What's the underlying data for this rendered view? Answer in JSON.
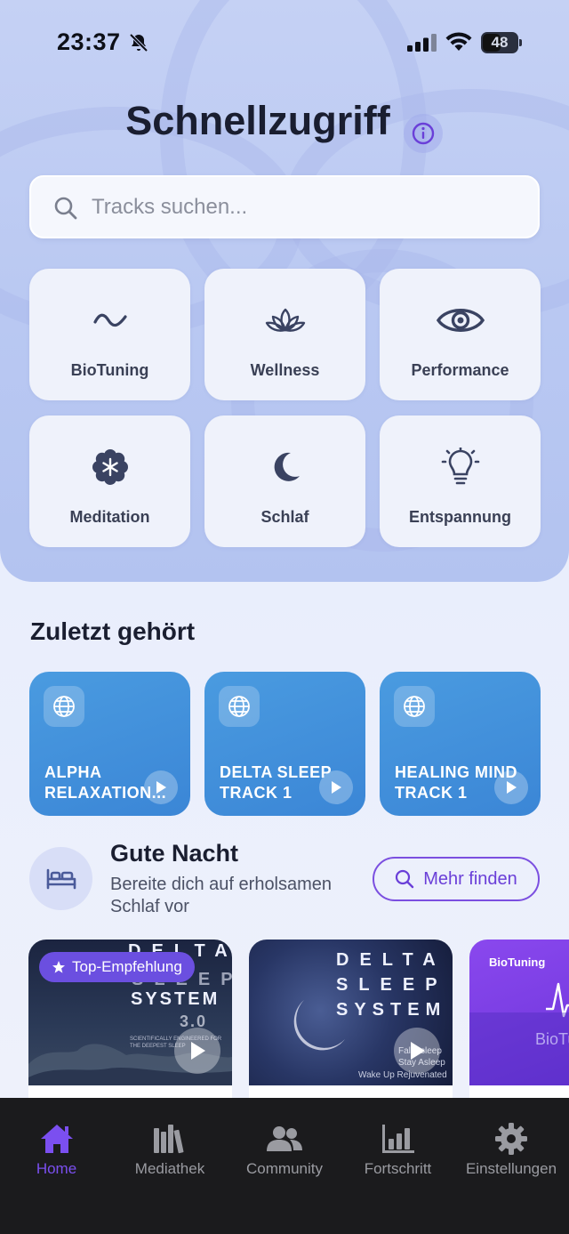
{
  "status_bar": {
    "time": "23:37",
    "battery": "48"
  },
  "header": {
    "title": "Schnellzugriff"
  },
  "search": {
    "placeholder": "Tracks suchen..."
  },
  "categories": [
    {
      "label": "BioTuning",
      "icon": "wave-icon"
    },
    {
      "label": "Wellness",
      "icon": "lotus-icon"
    },
    {
      "label": "Performance",
      "icon": "eye-icon"
    },
    {
      "label": "Meditation",
      "icon": "asterisk-flower-icon"
    },
    {
      "label": "Schlaf",
      "icon": "moon-icon"
    },
    {
      "label": "Entspannung",
      "icon": "lightbulb-icon"
    }
  ],
  "recent": {
    "title": "Zuletzt gehört",
    "items": [
      {
        "label": "ALPHA\nRELAXATION..."
      },
      {
        "label": "DELTA SLEEP\nTRACK 1"
      },
      {
        "label": "HEALING MIND\nTRACK 1"
      }
    ]
  },
  "good_night": {
    "title": "Gute Nacht",
    "subtitle": "Bereite dich auf erholsamen Schlaf vor",
    "more_button": "Mehr finden",
    "badge": "Top-Empfehlung",
    "cards": [
      {
        "line1": "DELTA",
        "line2": "SLEEP",
        "line3": "SYSTEM",
        "version": "3.0",
        "tag": "SCIENTIFICALLY ENGINEERED FOR THE DEEPEST SLEEP"
      },
      {
        "line1": "DELTA",
        "line2": "SLEEP",
        "line3": "SYSTEM",
        "tag1": "Fall Asleep",
        "tag2": "Stay Asleep",
        "tag3": "Wake Up Rejuvenated"
      },
      {
        "label": "BioTuning",
        "sublabel": "BioTu"
      }
    ]
  },
  "tabbar": {
    "tabs": [
      {
        "label": "Home",
        "icon": "home-icon",
        "active": true
      },
      {
        "label": "Mediathek",
        "icon": "library-icon",
        "active": false
      },
      {
        "label": "Community",
        "icon": "people-icon",
        "active": false
      },
      {
        "label": "Fortschritt",
        "icon": "chart-icon",
        "active": false
      },
      {
        "label": "Einstellungen",
        "icon": "gear-icon",
        "active": false
      }
    ]
  },
  "colors": {
    "accent": "#6a3fd8",
    "tile_bg": "#eff2fb",
    "recent_bg": "#3b86d6",
    "tabbar_bg": "#1b1b1d"
  }
}
